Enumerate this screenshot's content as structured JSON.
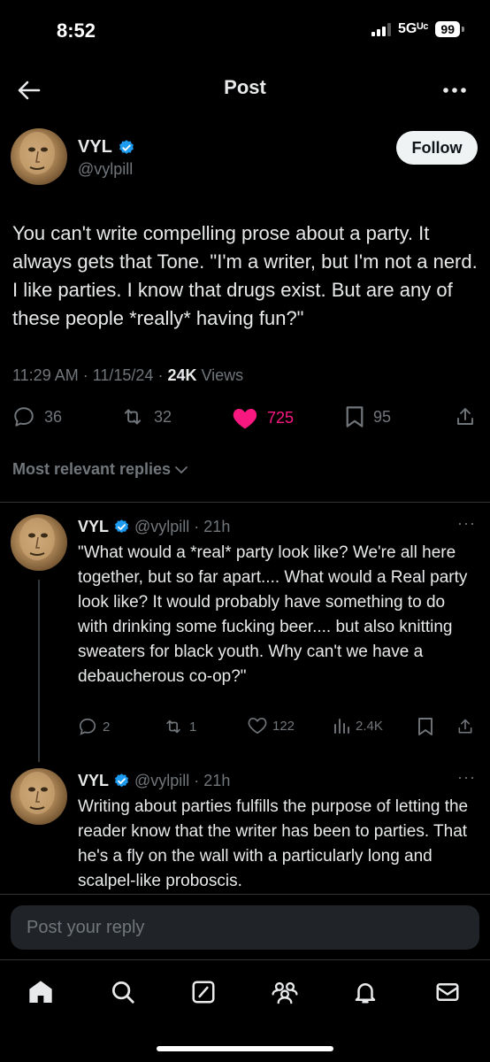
{
  "status_bar": {
    "time": "8:52",
    "network": "5Gᵁᶜ",
    "battery": "99"
  },
  "nav": {
    "title": "Post",
    "back_icon": "arrow-left-icon",
    "more_icon": "more-horizontal-icon"
  },
  "post": {
    "author_name": "VYL",
    "author_handle": "@vylpill",
    "follow_label": "Follow",
    "text": "You can't write compelling prose about a party. It always gets that Tone. \"I'm a writer, but I'm not a nerd. I like parties. I know that drugs exist. But are any of these people *really* having fun?\"",
    "meta_time": "11:29 AM · 11/15/24 · ",
    "views_count": "24K",
    "views_label": " Views",
    "actions": {
      "replies": "36",
      "reposts": "32",
      "likes": "725",
      "bookmarks": "95"
    }
  },
  "replies_filter": "Most relevant replies",
  "replies": [
    {
      "name": "VYL",
      "meta": "@vylpill · 21h",
      "text": "\"What would a *real* party look like? We're all here together, but so far apart.... What would a Real party look like? It would probably have something to do with drinking some fucking beer.... but also knitting sweaters for black youth. Why can't we have a debaucherous co-op?\"",
      "actions": {
        "replies": "2",
        "reposts": "1",
        "likes": "122",
        "views": "2.4K"
      }
    },
    {
      "name": "VYL",
      "meta": "@vylpill · 21h",
      "text": "Writing about parties fulfills the purpose of letting the reader know that the writer has been to parties. That he's a fly on the wall with a particularly long and scalpel-like proboscis."
    }
  ],
  "reply_bar": {
    "placeholder": "Post your reply"
  },
  "tabs": [
    "home-icon",
    "search-icon",
    "grok-icon",
    "communities-icon",
    "notifications-icon",
    "messages-icon"
  ],
  "colors": {
    "like": "#f91880",
    "verified": "#1d9bf0",
    "muted": "#71767b",
    "text": "#e7e9ea"
  }
}
